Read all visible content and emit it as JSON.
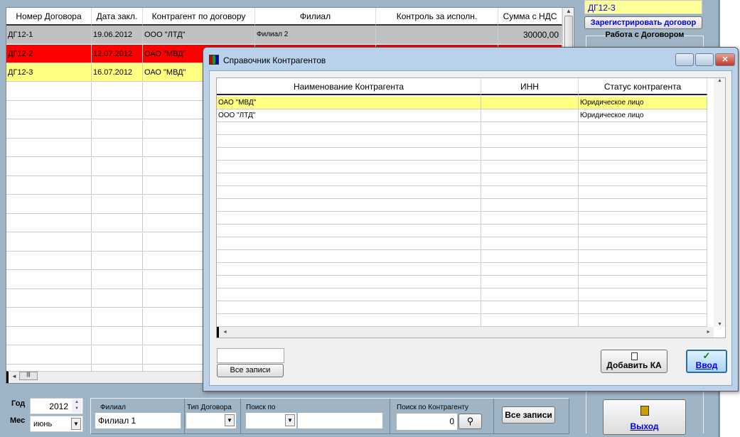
{
  "main_grid": {
    "columns": [
      "Номер Договора",
      "Дата закл.",
      "Контрагент по договору",
      "Филиал",
      "Контроль за исполн.",
      "Сумма с НДС"
    ],
    "rows": [
      {
        "num": "ДГ12-1",
        "date": "19.06.2012",
        "ka": "ООО \"ЛТД\"",
        "branch": "Филиал 2",
        "control": "",
        "sum": "30000,00",
        "color": "#c0c0c0"
      },
      {
        "num": "ДГ12-2",
        "date": "12.07.2012",
        "ka": "ОАО \"МВД\"",
        "branch": "",
        "control": "",
        "sum": "",
        "color": "#ff0000"
      },
      {
        "num": "ДГ12-3",
        "date": "16.07.2012",
        "ka": "ОАО \"МВД\"",
        "branch": "",
        "control": "",
        "sum": "",
        "color": "#ffff80"
      }
    ]
  },
  "right_panel": {
    "selected": "ДГ12-3",
    "register_button": "Зарегистрировать договор",
    "group_title": "Работа с Договором"
  },
  "dialog": {
    "title": "Справочник Контрагентов",
    "columns": [
      "Наименование Контрагента",
      "ИНН",
      "Статус контрагента"
    ],
    "rows": [
      {
        "name": "ОАО \"МВД\"",
        "inn": "",
        "status": "Юридическое лицо"
      },
      {
        "name": "ООО \"ЛТД\"",
        "inn": "",
        "status": "Юридическое лицо"
      }
    ],
    "search_value": "",
    "all_records": "Все записи",
    "add_button": "Добавить КА",
    "enter_button": "Ввод"
  },
  "bottom": {
    "year_label": "Год",
    "year": "2012",
    "month_label": "Мес",
    "month": "июнь",
    "branch_label": "Филиал",
    "branch": "Филиал 1",
    "type_label": "Тип Договора",
    "type": "",
    "search_by_label": "Поиск по",
    "search_by": "",
    "search_text": "",
    "ka_search_label": "Поиск по Контрагенту",
    "ka_search": "0",
    "all_records": "Все записи",
    "exit": "Выход"
  }
}
